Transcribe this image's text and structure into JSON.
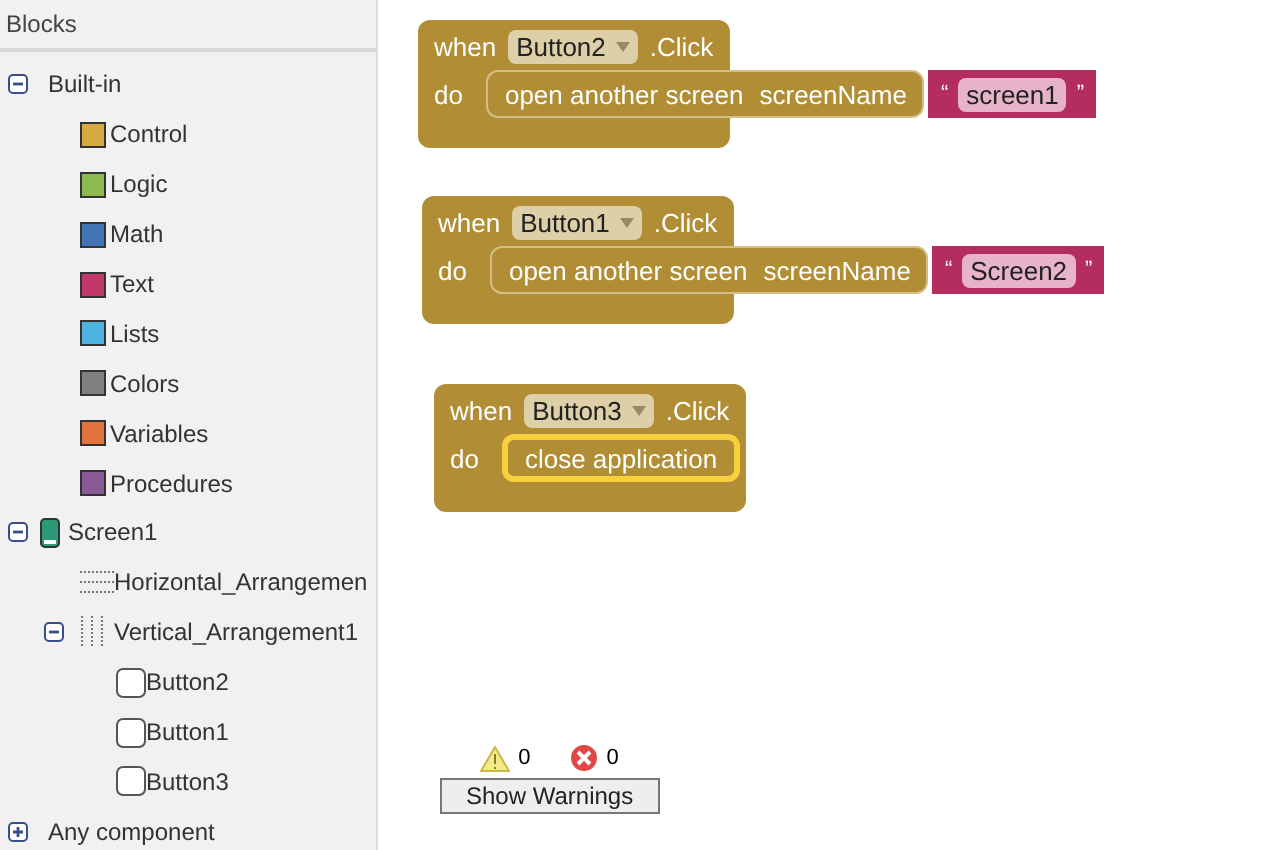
{
  "sidebar": {
    "title": "Blocks",
    "tree": [
      {
        "label": "Built-in",
        "kind": "group",
        "expanded": true,
        "children": [
          {
            "label": "Control",
            "kind": "category",
            "color": "#d6aa42"
          },
          {
            "label": "Logic",
            "kind": "category",
            "color": "#8cba4f"
          },
          {
            "label": "Math",
            "kind": "category",
            "color": "#4173b5"
          },
          {
            "label": "Text",
            "kind": "category",
            "color": "#c2386a"
          },
          {
            "label": "Lists",
            "kind": "category",
            "color": "#4cb3df"
          },
          {
            "label": "Colors",
            "kind": "category",
            "color": "#7f7f7f"
          },
          {
            "label": "Variables",
            "kind": "category",
            "color": "#e2733a"
          },
          {
            "label": "Procedures",
            "kind": "category",
            "color": "#8a5a96"
          }
        ]
      },
      {
        "label": "Screen1",
        "kind": "screen",
        "expanded": true,
        "children": [
          {
            "label": "Horizontal_Arrangemen",
            "kind": "horizontal"
          },
          {
            "label": "Vertical_Arrangement1",
            "kind": "vertical",
            "expanded": true,
            "children": [
              {
                "label": "Button2",
                "kind": "button"
              },
              {
                "label": "Button1",
                "kind": "button"
              },
              {
                "label": "Button3",
                "kind": "button"
              }
            ]
          }
        ]
      },
      {
        "label": "Any component",
        "kind": "group",
        "expanded": false
      }
    ]
  },
  "workspace": {
    "blocks": [
      {
        "when": "when",
        "component": "Button2",
        "event": ".Click",
        "do": "do",
        "selected": false,
        "statement": {
          "kind": "open_screen",
          "text": "open another screen",
          "param": "screenName",
          "quote_open": "“",
          "value": "screen1",
          "quote_close": "”"
        }
      },
      {
        "when": "when",
        "component": "Button1",
        "event": ".Click",
        "do": "do",
        "selected": false,
        "statement": {
          "kind": "open_screen",
          "text": "open another screen",
          "param": "screenName",
          "quote_open": "“",
          "value": "Screen2",
          "quote_close": "”"
        }
      },
      {
        "when": "when",
        "component": "Button3",
        "event": ".Click",
        "do": "do",
        "selected": true,
        "statement": {
          "kind": "simple",
          "text": "close application"
        }
      }
    ],
    "warnings": {
      "warning_count": "0",
      "error_count": "0",
      "button": "Show Warnings"
    }
  }
}
